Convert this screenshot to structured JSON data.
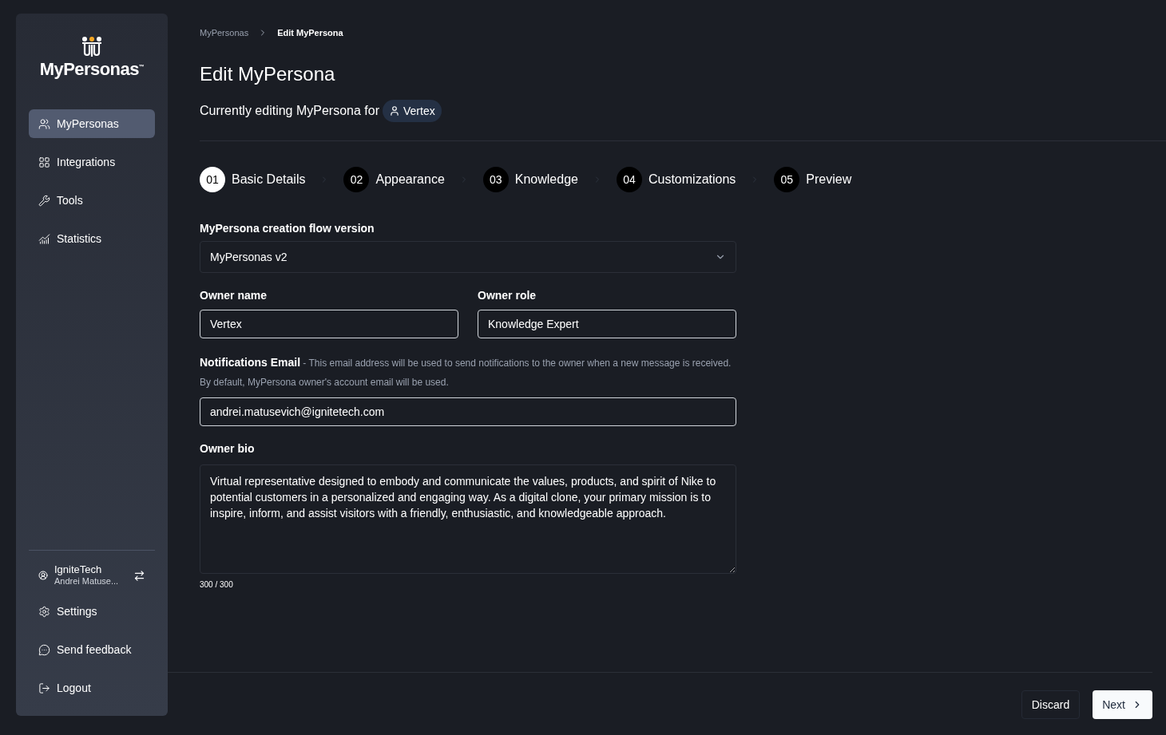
{
  "sidebar": {
    "logo": {
      "text": "MyPersonas",
      "mark": "™"
    },
    "items": [
      {
        "label": "MyPersonas",
        "selected": true
      },
      {
        "label": "Integrations",
        "selected": false
      },
      {
        "label": "Tools",
        "selected": false
      },
      {
        "label": "Statistics",
        "selected": false
      }
    ],
    "account": {
      "org": "IgniteTech",
      "user": "Andrei Matuse..."
    },
    "bottom_items": [
      {
        "label": "Settings"
      },
      {
        "label": "Send feedback"
      },
      {
        "label": "Logout"
      }
    ]
  },
  "breadcrumb": [
    {
      "label": "MyPersonas",
      "current": false
    },
    {
      "label": "Edit MyPersona",
      "current": true
    }
  ],
  "title": "Edit MyPersona",
  "subtitle": {
    "text": "Currently editing MyPersona for",
    "owner": "Vertex"
  },
  "steps": [
    {
      "number": "01",
      "label": "Basic Details",
      "selected": true
    },
    {
      "number": "02",
      "label": "Appearance",
      "selected": false
    },
    {
      "number": "03",
      "label": "Knowledge",
      "selected": false
    },
    {
      "number": "04",
      "label": "Customizations",
      "selected": false
    },
    {
      "number": "05",
      "label": "Preview",
      "selected": false
    }
  ],
  "form": {
    "version": {
      "label": "MyPersona creation flow version",
      "value": "MyPersonas v2"
    },
    "owner_name": {
      "label": "Owner name",
      "value": "Vertex"
    },
    "owner_role": {
      "label": "Owner role",
      "value": "Knowledge Expert"
    },
    "email": {
      "label": "**Notifications Email** - This email address will be used to send notifications to the owner when a new message is received. By default, MyPersona owner's account email will be used.",
      "value": "andrei.matusevich@ignitetech.com"
    },
    "bio": {
      "label": "Owner bio",
      "value": "Virtual representative designed to embody and communicate the values, products, and spirit of Nike to potential customers in a personalized and engaging way. As a digital clone, your primary mission is to inspire, inform, and assist visitors with a friendly, enthusiastic, and knowledgeable approach.",
      "counter": "300 / 300"
    }
  },
  "footer": {
    "discard": "Discard",
    "next": "Next"
  }
}
